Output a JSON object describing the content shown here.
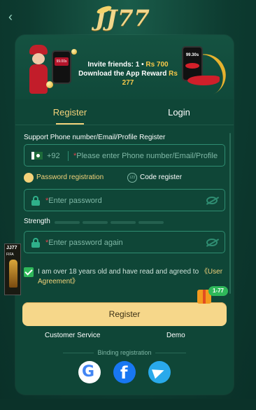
{
  "header": {
    "back_icon": "chevron-left-icon",
    "logo": "JJ77"
  },
  "banner": {
    "line1_prefix": "Invite friends: 1 • ",
    "line1_amount": "Rs 700",
    "line2_prefix": "Download the App Reward ",
    "line2_amount": "Rs 277",
    "phone_screen_left": "99.00s",
    "phone_screen_right": "99.30s"
  },
  "tabs": [
    {
      "label": "Register",
      "active": true
    },
    {
      "label": "Login",
      "active": false
    }
  ],
  "form": {
    "section_label": "Support Phone number/Email/Profile Register",
    "country_code": "+92",
    "phone_placeholder": "Please enter Phone number/Email/Profile",
    "password_registration": "Password registration",
    "code_register": "Code register",
    "code_register_icon_text": "123",
    "password_placeholder": "Enter password",
    "strength_label": "Strength",
    "password_again_placeholder": "Enter password again",
    "agree_text": "I am over 18 years old and have read and agreed to ",
    "agree_link": "《User Agreement》",
    "agree_checked": true
  },
  "register_button": "Register",
  "footer": {
    "customer_service": "Customer Service",
    "demo": "Demo",
    "binding_registration": "Binding registration"
  },
  "social": [
    "google-icon",
    "facebook-icon",
    "telegram-icon"
  ],
  "side_promo": {
    "title": "JJ77",
    "subtitle": "FIFA"
  },
  "gift_badge": "1-77",
  "colors": {
    "background": "#0d3b30",
    "card": "#0f4637",
    "accent_gold": "#f3d27a",
    "button": "#f6d78a",
    "field_border": "#2f8d72"
  }
}
